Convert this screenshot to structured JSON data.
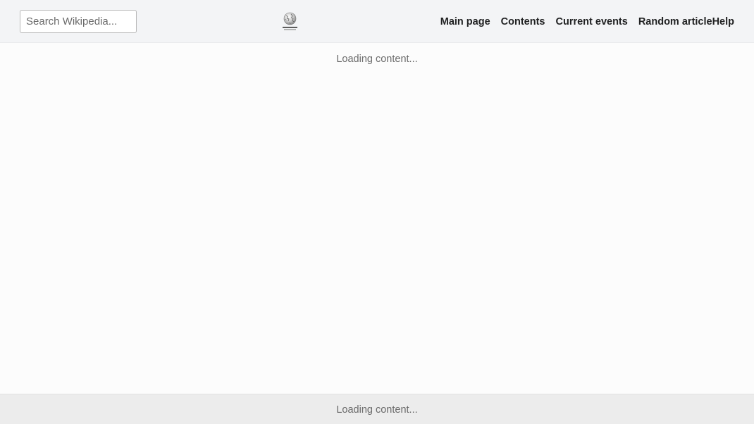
{
  "header": {
    "search": {
      "placeholder": "Search Wikipedia...",
      "value": ""
    },
    "logo": {
      "icon": "wikipedia-globe-logo"
    },
    "nav": {
      "items": [
        {
          "label": "Main page"
        },
        {
          "label": "Contents"
        },
        {
          "label": "Current events"
        },
        {
          "label": "Random article"
        },
        {
          "label": "Help"
        }
      ]
    }
  },
  "main": {
    "loading_text": "Loading content..."
  },
  "footer": {
    "loading_text": "Loading content..."
  },
  "colors": {
    "header_bg": "#f3f4f6",
    "page_bg": "#fcfcfc",
    "footer_bg": "#ececec",
    "nav_text": "#202122",
    "muted_text": "#6b6b6b"
  }
}
